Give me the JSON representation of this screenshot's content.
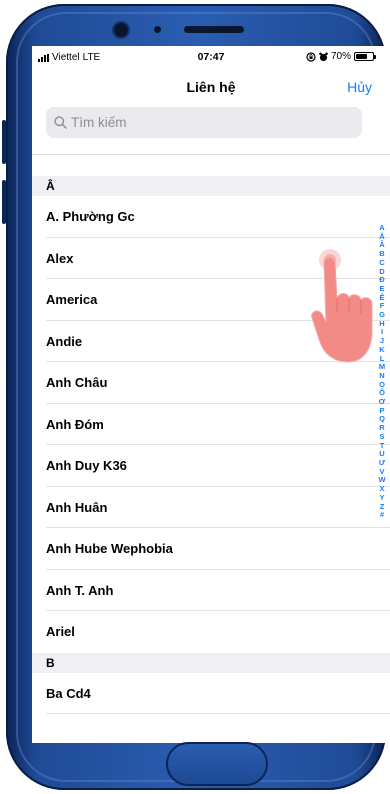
{
  "status_bar": {
    "carrier": "Viettel",
    "network": "LTE",
    "time": "07:47",
    "battery_percent": "70%",
    "battery_level": 0.7
  },
  "nav": {
    "title": "Liên hệ",
    "cancel_label": "Hủy"
  },
  "search": {
    "placeholder": "Tìm kiếm"
  },
  "sections": [
    {
      "header": "Â",
      "contacts": [
        "A. Phường Gc",
        "Alex",
        "America",
        "Andie",
        "Anh Châu",
        "Anh Đóm",
        "Anh Duy K36",
        "Anh Huân",
        "Anh Hube Wephobia",
        "Anh T. Anh",
        "Ariel"
      ]
    },
    {
      "header": "B",
      "contacts": [
        "Ba Cd4"
      ]
    }
  ],
  "index_letters": [
    "A",
    "Ă",
    "Â",
    "B",
    "C",
    "D",
    "Đ",
    "E",
    "Ê",
    "F",
    "G",
    "H",
    "I",
    "J",
    "K",
    "L",
    "M",
    "N",
    "O",
    "Ô",
    "Ơ",
    "P",
    "Q",
    "R",
    "S",
    "T",
    "U",
    "Ư",
    "V",
    "W",
    "X",
    "Y",
    "Z",
    "#"
  ],
  "colors": {
    "accent": "#1a7cf5",
    "frame": "#2a5db1",
    "hand": "#f28b85"
  }
}
